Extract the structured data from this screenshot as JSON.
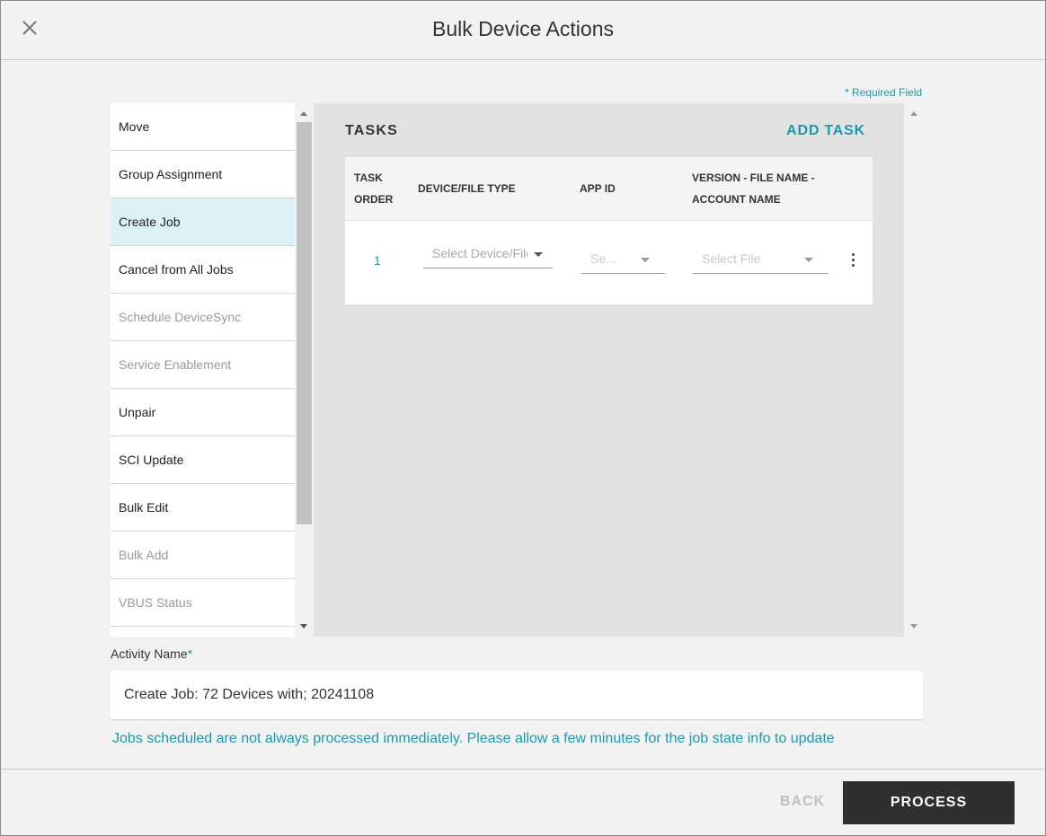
{
  "dialog": {
    "title": "Bulk Device Actions",
    "close_icon": "close-icon",
    "required_note": "* Required Field"
  },
  "actions": [
    {
      "label": "Move",
      "state": "enabled"
    },
    {
      "label": "Group Assignment",
      "state": "enabled"
    },
    {
      "label": "Create Job",
      "state": "selected"
    },
    {
      "label": "Cancel from All Jobs",
      "state": "enabled"
    },
    {
      "label": "Schedule DeviceSync",
      "state": "disabled"
    },
    {
      "label": "Service Enablement",
      "state": "disabled"
    },
    {
      "label": "Unpair",
      "state": "enabled"
    },
    {
      "label": "SCI Update",
      "state": "enabled"
    },
    {
      "label": "Bulk Edit",
      "state": "enabled"
    },
    {
      "label": "Bulk Add",
      "state": "disabled"
    },
    {
      "label": "VBUS Status",
      "state": "disabled"
    }
  ],
  "tasks": {
    "title": "TASKS",
    "add_label": "ADD TASK",
    "columns": {
      "order_line1": "TASK",
      "order_line2": "ORDER",
      "device_type": "DEVICE/FILE TYPE",
      "app_id": "APP ID",
      "version_line1": "VERSION - FILE NAME -",
      "version_line2": "ACCOUNT NAME"
    },
    "rows": [
      {
        "order": "1",
        "device_placeholder": "Select Device/File Type",
        "app_placeholder": "Se...",
        "file_placeholder": "Select File"
      }
    ]
  },
  "activity": {
    "label": "Activity Name",
    "required_mark": "*",
    "value": "Create Job: 72 Devices with; 20241108"
  },
  "info_text": "Jobs scheduled are not always processed immediately. Please allow a few minutes for the job state info to update",
  "footer": {
    "back_label": "BACK",
    "process_label": "PROCESS"
  },
  "colors": {
    "accent": "#1a9aad",
    "selected_bg": "#dcf1f7",
    "primary_button": "#2f2f2f"
  }
}
